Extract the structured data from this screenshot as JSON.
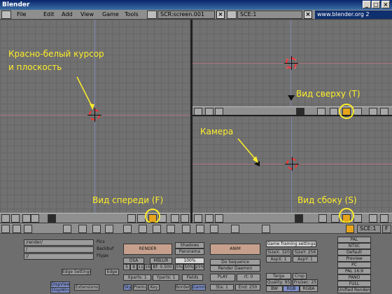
{
  "window": {
    "title": "Blender"
  },
  "menubar": {
    "items": [
      "File",
      "Edit",
      "Add",
      "View",
      "Game",
      "Tools"
    ],
    "screen_field": "SCR:screen.001",
    "scene_field": "SCE:1",
    "url": "www.blender.org 2"
  },
  "annotations": {
    "cursor_note": "Красно-белый курсор",
    "cursor_note2": "и плоскость",
    "top_view": "Вид сверху (T)",
    "camera": "Камера",
    "front_view": "Вид спереди (F)",
    "side_view": "Вид сбоку (S)"
  },
  "buttons_header": {
    "scene_field": "SCE:1",
    "frame_field": "F"
  },
  "render_panel": {
    "path_fields": [
      "/render/",
      "/",
      "//"
    ],
    "path_labels": [
      "Pics",
      "Backbuf",
      "Ftype"
    ],
    "extra": [
      "Edge Settings",
      "Edge"
    ],
    "bottom_buttons": [
      "DispView",
      "DispWin",
      "Extensions"
    ],
    "render_button": "RENDER",
    "anim_button": "ANIM",
    "shadows": "Shadows",
    "panorama": "Panorama",
    "osa": "OSA",
    "mblur": "MBLUR",
    "percent": "100%",
    "osa_levels": [
      "5",
      "8",
      "11",
      "16"
    ],
    "blur_value": "Bf: 0.500",
    "scale_options": [
      "5%",
      "50%",
      "25%"
    ],
    "do_sequence": "Do Sequence",
    "render_daemon": "Render Daemon",
    "xparts": "Xparts: 1",
    "yparts": "Yparts: 1",
    "fields": "Fields",
    "play": "PLAY",
    "rt": "rt: 0",
    "sky": "Sky",
    "premul": "Premul",
    "key": "Key",
    "border": "Border",
    "gamma": "Gamma",
    "sta": "Sta: 1",
    "end": "End: 250"
  },
  "format_panel": {
    "header": "Game framing settings",
    "sizex": "SizeX: 320",
    "sizey": "SizeY: 256",
    "aspx": "AspX: 1",
    "aspy": "AspY: 1",
    "targa": "Targa",
    "crop": "Crop",
    "quality": "Quality: 95",
    "frs": "Frs/sec: 25",
    "bw": "BW",
    "rgb": "RGB",
    "rgba": "RGBA"
  },
  "preset_panel": [
    "PAL",
    "NTSC",
    "Default",
    "Preview",
    "PC",
    "PAL 16:9",
    "PANO",
    "FULL",
    "Unified Renderer"
  ]
}
